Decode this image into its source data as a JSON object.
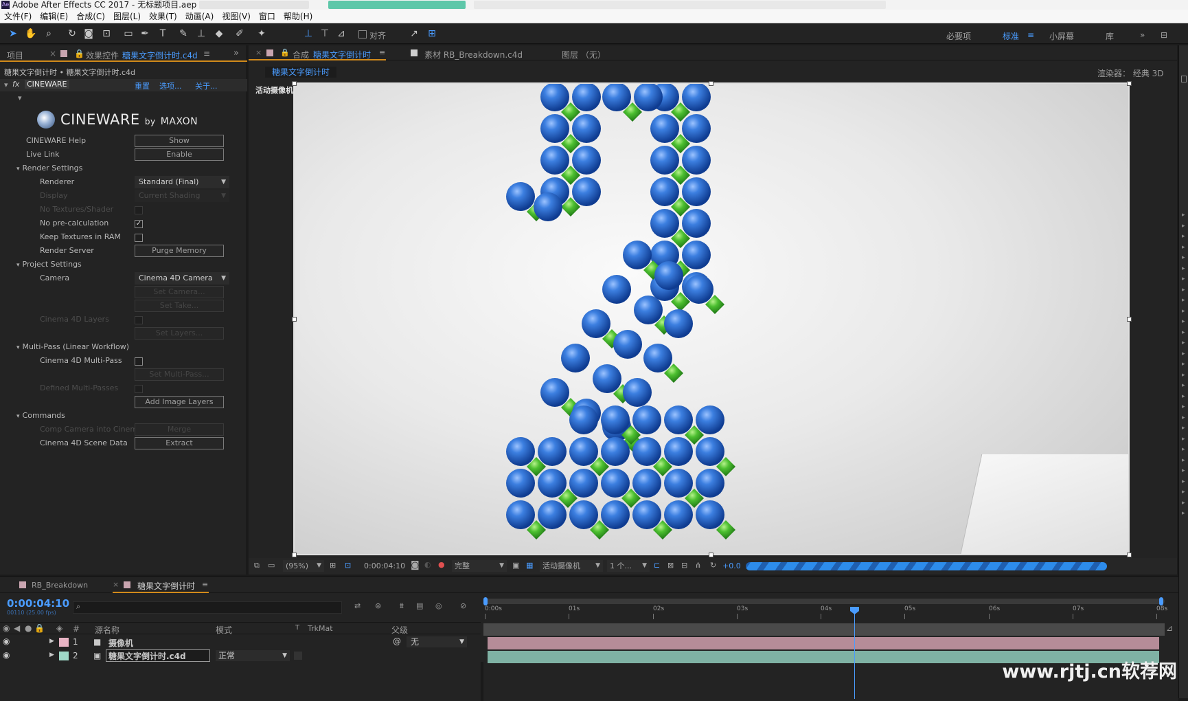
{
  "window": {
    "title": "Adobe After Effects CC 2017 - 无标题项目.aep *",
    "app_badge": "Ae"
  },
  "menu": [
    "文件(F)",
    "编辑(E)",
    "合成(C)",
    "图层(L)",
    "效果(T)",
    "动画(A)",
    "视图(V)",
    "窗口",
    "帮助(H)"
  ],
  "toolbar": {
    "snap_label": "对齐",
    "workspaces": [
      "必要项",
      "标准",
      "小屏幕",
      "库"
    ],
    "active_workspace": "标准"
  },
  "left_panel": {
    "tab_project": "项目",
    "tab_effects_prefix": "效果控件",
    "tab_effects_name": "糖果文字倒计时.c4d",
    "breadcrumb": "糖果文字倒计时 • 糖果文字倒计时.c4d",
    "fx_name": "CINEWARE",
    "fx_links": [
      "重置",
      "选项...",
      "关于..."
    ],
    "logo_main": "CINEWARE",
    "logo_by": "by",
    "logo_brand": "MAXON",
    "rows": {
      "help_label": "CINEWARE Help",
      "help_btn": "Show",
      "livelink_label": "Live Link",
      "livelink_btn": "Enable",
      "render_settings": "Render Settings",
      "renderer_label": "Renderer",
      "renderer_value": "Standard (Final)",
      "display_label": "Display",
      "display_value": "Current Shading",
      "notex_label": "No Textures/Shader",
      "noprecalc_label": "No pre-calculation",
      "keeptex_label": "Keep Textures in RAM",
      "renderserver_label": "Render Server",
      "purge_btn": "Purge Memory",
      "project_settings": "Project Settings",
      "camera_label": "Camera",
      "camera_value": "Cinema 4D Camera",
      "setcamera_btn": "Set Camera...",
      "settake_btn": "Set Take...",
      "c4dlayers_label": "Cinema 4D Layers",
      "setlayers_btn": "Set Layers...",
      "multipass": "Multi-Pass (Linear Workflow)",
      "c4dmultipass_label": "Cinema 4D Multi-Pass",
      "setmultipass_btn": "Set Multi-Pass...",
      "definedpasses_label": "Defined Multi-Passes",
      "addlayers_btn": "Add Image Layers",
      "commands": "Commands",
      "compcamera_label": "Comp Camera into Cinem",
      "merge_btn": "Merge",
      "scenedata_label": "Cinema 4D Scene Data",
      "extract_btn": "Extract"
    }
  },
  "comp_panel": {
    "tab_comp_prefix": "合成",
    "tab_comp_name": "糖果文字倒计时",
    "tab_footage": "素材 RB_Breakdown.c4d",
    "tab_layer": "图层 （无）",
    "breadcrumb_comp": "糖果文字倒计时",
    "renderer_label": "渲染器：",
    "renderer_value": "经典 3D",
    "camera_overlay": "活动摄像机",
    "bottom": {
      "zoom": "(95%)",
      "timecode": "0:00:04:10",
      "resolution": "完整",
      "view": "活动摄像机",
      "views_count": "1 个...",
      "exposure": "+0.0"
    }
  },
  "timeline": {
    "tabs": [
      "RB_Breakdown",
      "糖果文字倒计时"
    ],
    "current_time": "0:00:04:10",
    "frame_info": "00110 (25.00 fps)",
    "search_placeholder": "",
    "columns": {
      "num": "#",
      "source": "源名称",
      "mode": "模式",
      "t": "T",
      "trkmat": "TrkMat",
      "parent": "父级"
    },
    "ruler": [
      "0:00s",
      "01s",
      "02s",
      "03s",
      "04s",
      "05s",
      "06s",
      "07s",
      "08s"
    ],
    "playhead_fraction": 0.552,
    "layers": [
      {
        "num": "1",
        "name": "摄像机",
        "mode": "",
        "parent": "无",
        "color": "#e8b4c4",
        "bar_color": "#b58c98"
      },
      {
        "num": "2",
        "name": "糖果文字倒计时.c4d",
        "mode": "正常",
        "parent": "",
        "color": "#9fd8c8",
        "bar_color": "#7fb2a4"
      }
    ]
  },
  "watermark": "www.rjtj.cn软荐网",
  "colors": {
    "accent": "#2d8ceb",
    "panel": "#232323",
    "sphere_blue": "#1f63c7",
    "sphere_green": "#3fae2e"
  }
}
